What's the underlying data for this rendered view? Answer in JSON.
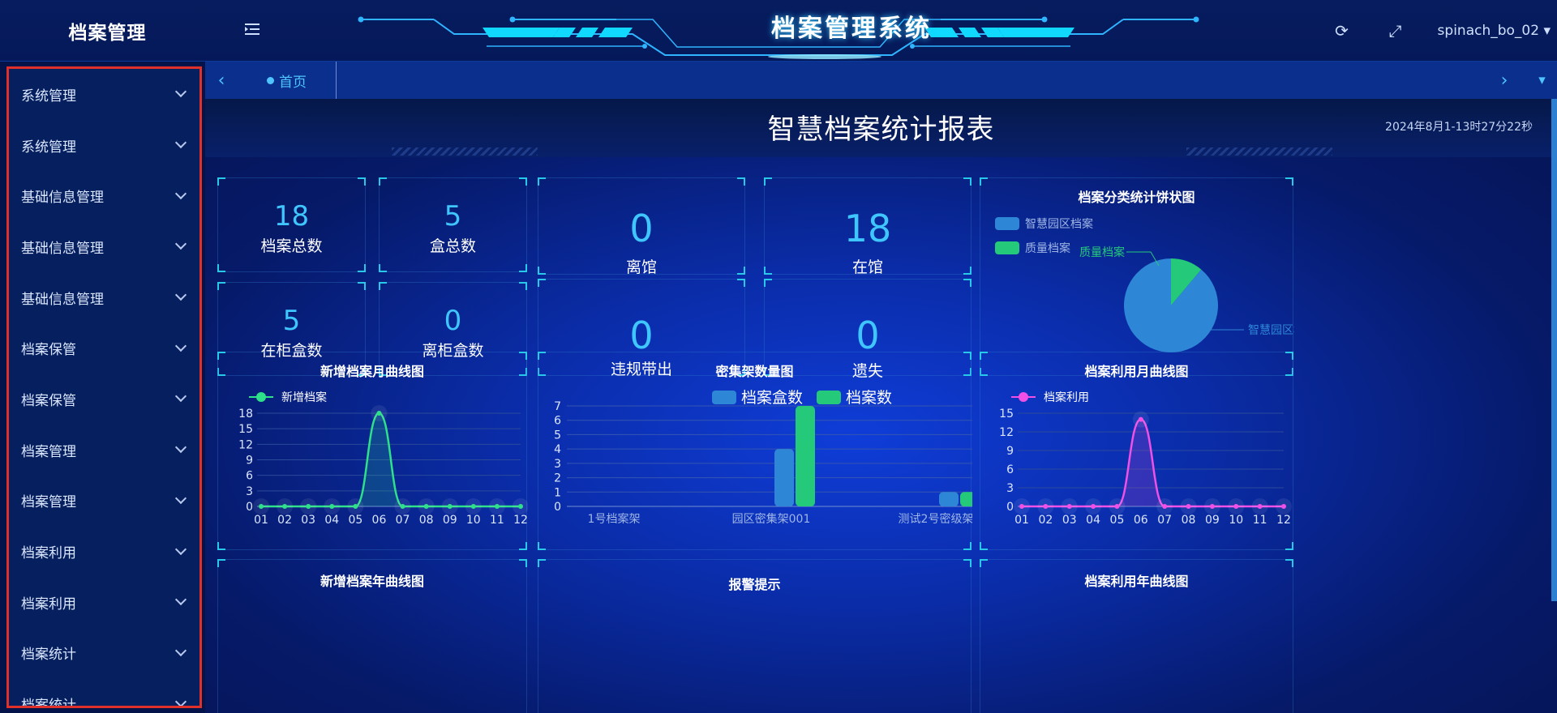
{
  "header": {
    "brand": "档案管理",
    "system_title": "档案管理系统",
    "menu_toggle_icon": "menu-fold-icon",
    "refresh_icon": "refresh-icon",
    "fullscreen_icon": "fullscreen-icon",
    "username": "spinach_bo_02 ▾"
  },
  "sidebar": {
    "items": [
      {
        "label": "系统管理"
      },
      {
        "label": "系统管理"
      },
      {
        "label": "基础信息管理"
      },
      {
        "label": "基础信息管理"
      },
      {
        "label": "基础信息管理"
      },
      {
        "label": "档案保管"
      },
      {
        "label": "档案保管"
      },
      {
        "label": "档案管理"
      },
      {
        "label": "档案管理"
      },
      {
        "label": "档案利用"
      },
      {
        "label": "档案利用"
      },
      {
        "label": "档案统计"
      },
      {
        "label": "档案统计"
      }
    ]
  },
  "tabs": {
    "prev": "‹",
    "next": "›",
    "more": "▾",
    "home": "首页"
  },
  "report": {
    "title": "智慧档案统计报表",
    "time": "2024年8月1-13时27分22秒"
  },
  "stats": {
    "total_archives": {
      "value": "18",
      "label": "档案总数"
    },
    "total_boxes": {
      "value": "5",
      "label": "盒总数"
    },
    "in_cabinet_boxes": {
      "value": "5",
      "label": "在柜盒数"
    },
    "out_cabinet_boxes": {
      "value": "0",
      "label": "离柜盒数"
    },
    "out_of_library": {
      "value": "0",
      "label": "离馆"
    },
    "in_library": {
      "value": "18",
      "label": "在馆"
    },
    "illegal_out": {
      "value": "0",
      "label": "违规带出"
    },
    "lost": {
      "value": "0",
      "label": "遗失"
    }
  },
  "bottom_titles": {
    "new_yearly": "新增档案年曲线图",
    "alarm": "报警提示",
    "usage_yearly": "档案利用年曲线图"
  },
  "chart_data": [
    {
      "type": "line",
      "title": "新增档案月曲线图",
      "categories": [
        "01",
        "02",
        "03",
        "04",
        "05",
        "06",
        "07",
        "08",
        "09",
        "10",
        "11",
        "12"
      ],
      "series": [
        {
          "name": "新增档案",
          "values": [
            0,
            0,
            0,
            0,
            0,
            18,
            0,
            0,
            0,
            0,
            0,
            0
          ],
          "color": "#2ee08a"
        }
      ],
      "yticks": [
        0,
        3,
        6,
        9,
        12,
        15,
        18
      ],
      "ylim": [
        0,
        18
      ],
      "legend": "top-left"
    },
    {
      "type": "bar",
      "title": "密集架数量图",
      "categories": [
        "1号档案架",
        "园区密集架001",
        "测试2号密级架"
      ],
      "series": [
        {
          "name": "档案盒数",
          "values": [
            0,
            4,
            1
          ],
          "color": "#2e86d6"
        },
        {
          "name": "档案数",
          "values": [
            0,
            7,
            1
          ],
          "color": "#25c97a"
        }
      ],
      "yticks": [
        0,
        1,
        2,
        3,
        4,
        5,
        6,
        7
      ],
      "ylim": [
        0,
        7
      ],
      "legend": "top-center"
    },
    {
      "type": "line",
      "title": "档案利用月曲线图",
      "categories": [
        "01",
        "02",
        "03",
        "04",
        "05",
        "06",
        "07",
        "08",
        "09",
        "10",
        "11",
        "12"
      ],
      "series": [
        {
          "name": "档案利用",
          "values": [
            0,
            0,
            0,
            0,
            0,
            14,
            0,
            0,
            0,
            0,
            0,
            0
          ],
          "color": "#f050e6"
        }
      ],
      "yticks": [
        0,
        3,
        6,
        9,
        12,
        15
      ],
      "ylim": [
        0,
        15
      ],
      "legend": "top-left"
    },
    {
      "type": "pie",
      "title": "档案分类统计饼状图",
      "slices": [
        {
          "name": "智慧园区档案",
          "value": 16,
          "color": "#2e86d6"
        },
        {
          "name": "质量档案",
          "value": 2,
          "color": "#25c97a"
        }
      ],
      "legend": "top-left"
    }
  ]
}
